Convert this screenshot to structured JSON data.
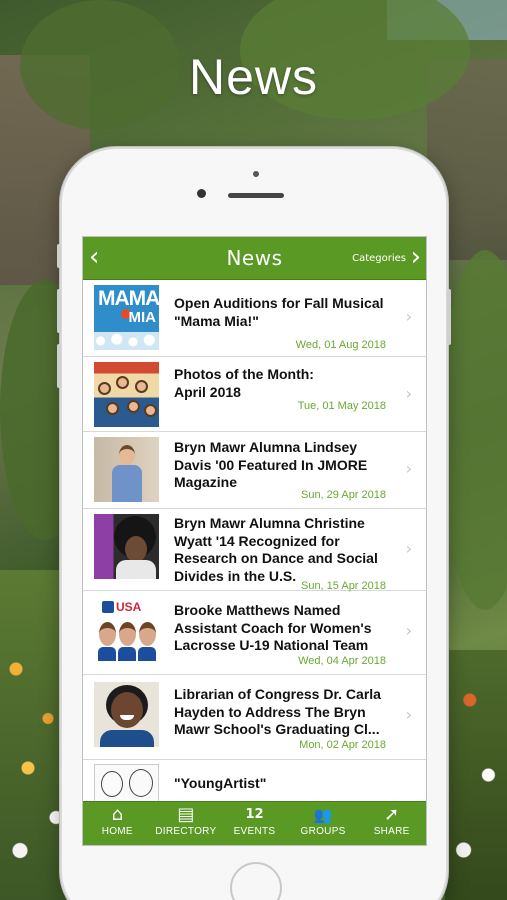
{
  "hero": {
    "title": "News"
  },
  "app": {
    "nav": {
      "back": "‹",
      "title": "News",
      "categories": "Categories",
      "forward": "›"
    },
    "news": [
      {
        "title": "Open Auditions for Fall Musical\n\"Mama Mia!\"",
        "date": "Wed, 01 Aug 2018",
        "thumb_text_1": "MAMA",
        "thumb_text_2": "MIA"
      },
      {
        "title": "Photos of the Month:\nApril 2018",
        "date": "Tue, 01 May 2018"
      },
      {
        "title": "Bryn Mawr Alumna Lindsey\nDavis '00 Featured In JMORE\nMagazine",
        "date": "Sun, 29 Apr 2018"
      },
      {
        "title": "Bryn Mawr Alumna Christine\nWyatt '14 Recognized for\nResearch on Dance and Social\nDivides in the U.S.",
        "date": "Sun, 15 Apr 2018"
      },
      {
        "title": "Brooke Matthews Named\nAssistant Coach for Women's\nLacrosse U-19 National Team",
        "date": "Wed, 04 Apr 2018",
        "thumb_text_1": "USA"
      },
      {
        "title": "Librarian of Congress Dr. Carla\nHayden to Address  The Bryn\nMawr School's Graduating Cl...",
        "date": "Mon, 02 Apr 2018"
      },
      {
        "title": "\"YoungArtist\"",
        "date": ""
      }
    ],
    "tabs": [
      {
        "label": "HOME",
        "icon": "home-icon",
        "glyph": "⌂"
      },
      {
        "label": "DIRECTORY",
        "icon": "directory-icon",
        "glyph": "▤"
      },
      {
        "label": "EVENTS",
        "icon": "calendar-icon",
        "glyph": "12"
      },
      {
        "label": "GROUPS",
        "icon": "groups-icon",
        "glyph": "👥"
      },
      {
        "label": "SHARE",
        "icon": "share-icon",
        "glyph": "➚"
      }
    ],
    "colors": {
      "brand_green": "#5a9a24",
      "date_green": "#6aa832"
    }
  }
}
